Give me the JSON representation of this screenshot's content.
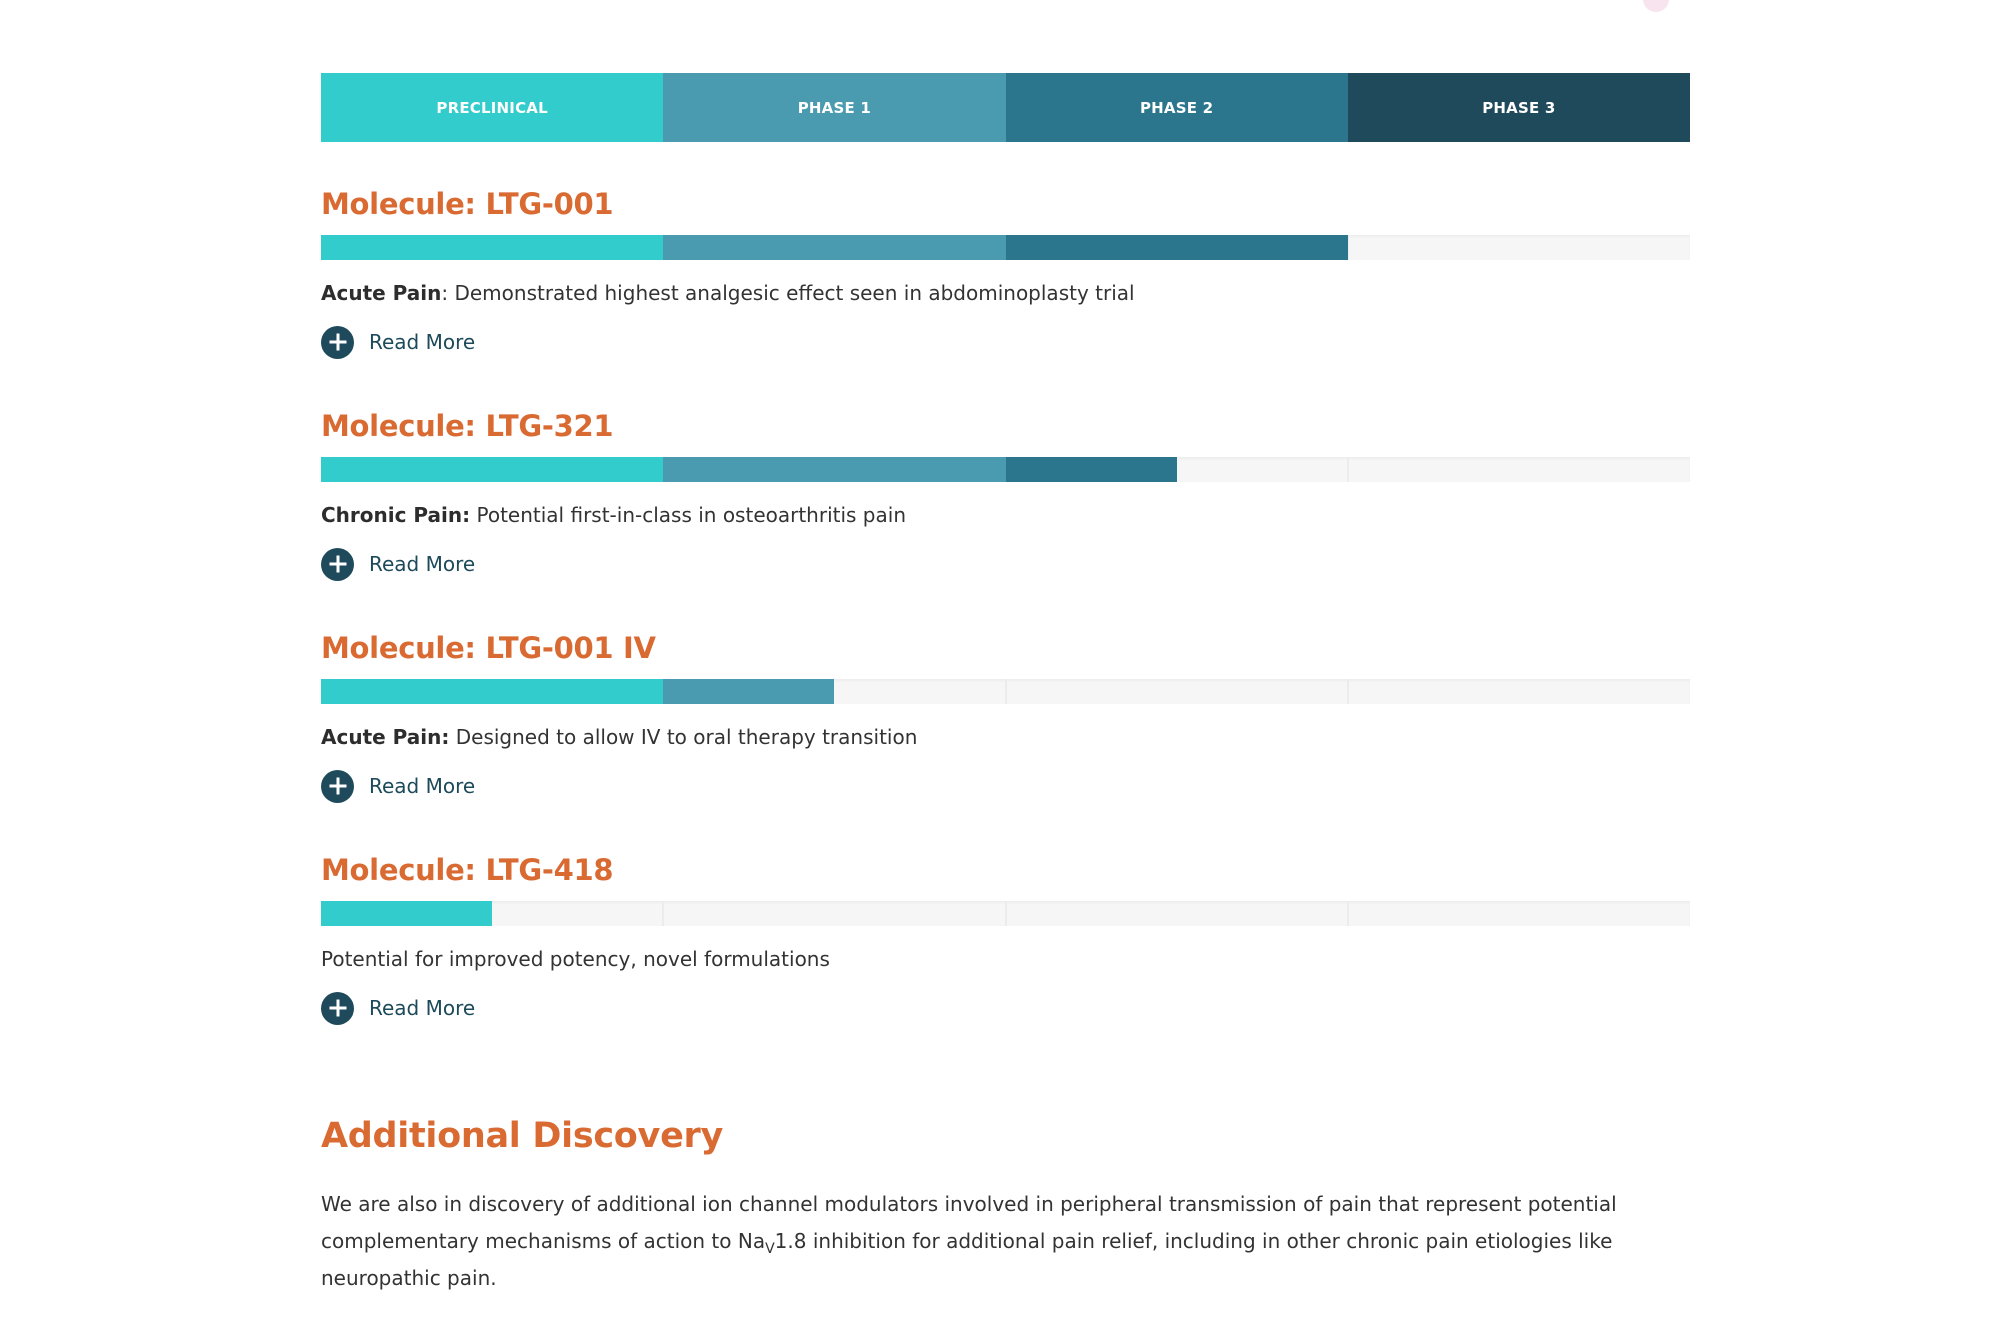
{
  "colors": {
    "preclinical": "#33cccc",
    "phase_1": "#4a9bb0",
    "phase_2": "#2b768c",
    "phase_3": "#1f4a5c",
    "heading": "#d96a32",
    "read_more_icon": "#1f4a5c"
  },
  "phases": [
    {
      "label": "PRECLINICAL",
      "color": "#33cccc"
    },
    {
      "label": "PHASE 1",
      "color": "#4a9bb0"
    },
    {
      "label": "PHASE 2",
      "color": "#2b768c"
    },
    {
      "label": "PHASE 3",
      "color": "#1f4a5c"
    }
  ],
  "molecules": [
    {
      "title": "Molecule: LTG-001",
      "progress_phases": 3,
      "lead": "Acute Pain",
      "desc": ": Demonstrated highest analgesic effect seen in abdominoplasty trial",
      "read_more": "Read More",
      "icon": "plus-circle-icon"
    },
    {
      "title": "Molecule: LTG-321",
      "progress_phases": 2.5,
      "lead": "Chronic Pain:",
      "desc": " Potential first-in-class in osteoarthritis pain",
      "read_more": "Read More",
      "icon": "plus-circle-icon"
    },
    {
      "title": "Molecule: LTG-001 IV",
      "progress_phases": 1.5,
      "lead": "Acute Pain:",
      "desc": " Designed to allow IV to oral therapy transition",
      "read_more": "Read More",
      "icon": "plus-circle-icon"
    },
    {
      "title": "Molecule: LTG-418",
      "progress_phases": 0.5,
      "lead": "",
      "desc": "Potential for improved potency, novel formulations",
      "read_more": "Read More",
      "icon": "plus-circle-icon"
    }
  ],
  "additional": {
    "title": "Additional Discovery",
    "body_part1": "We are also in discovery of additional ion channel modulators involved in peripheral transmission of pain that represent potential complementary mechanisms of action to Na",
    "body_sub": "V",
    "body_part2": "1.8 inhibition for additional pain relief, including in other chronic pain etiologies like neuropathic pain."
  }
}
